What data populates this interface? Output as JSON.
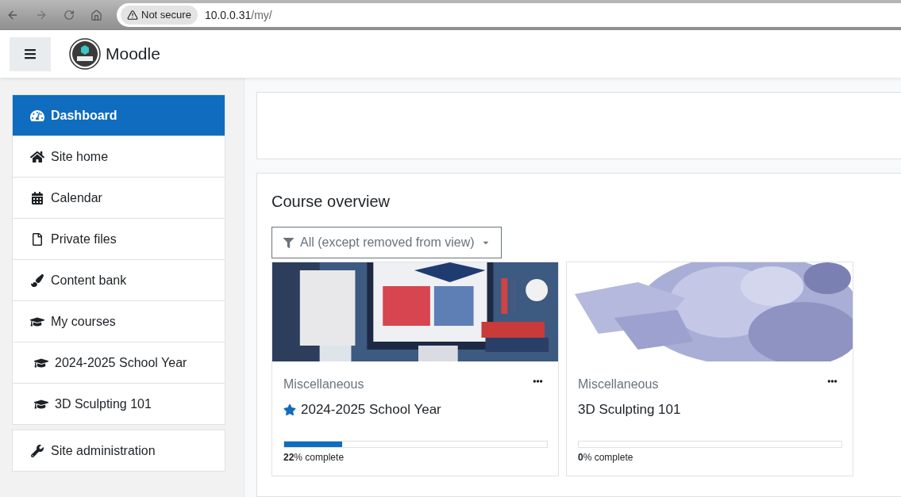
{
  "browser": {
    "security": "Not secure",
    "url_host": "10.0.0.31",
    "url_path": "/my/"
  },
  "navbar": {
    "site_name": "Moodle"
  },
  "sidebar": {
    "items": [
      {
        "kind": "dashboard",
        "label": "Dashboard",
        "selected": true
      },
      {
        "kind": "home",
        "label": "Site home",
        "selected": false
      },
      {
        "kind": "calendar",
        "label": "Calendar",
        "selected": false
      },
      {
        "kind": "file",
        "label": "Private files",
        "selected": false
      },
      {
        "kind": "brush",
        "label": "Content bank",
        "selected": false
      },
      {
        "kind": "course",
        "label": "My courses",
        "selected": false,
        "children": [
          {
            "kind": "course",
            "label": "2024-2025 School Year",
            "selected": false
          },
          {
            "kind": "course",
            "label": "3D Sculpting 101",
            "selected": false
          }
        ]
      }
    ],
    "admin_items": [
      {
        "kind": "admin",
        "label": "Site administration",
        "selected": false
      }
    ]
  },
  "course_overview": {
    "title": "Course overview",
    "filter": "All (except removed from view)",
    "courses": [
      {
        "kind": "picture",
        "category": "Miscellaneous",
        "name": "2024-2025 School Year",
        "starred": true,
        "level": 0.22,
        "progress": "**22**% complete"
      },
      {
        "kind": "picture",
        "category": "Miscellaneous",
        "name": "3D Sculpting 101",
        "starred": false,
        "level": 0,
        "progress": "**0**% complete"
      }
    ]
  }
}
